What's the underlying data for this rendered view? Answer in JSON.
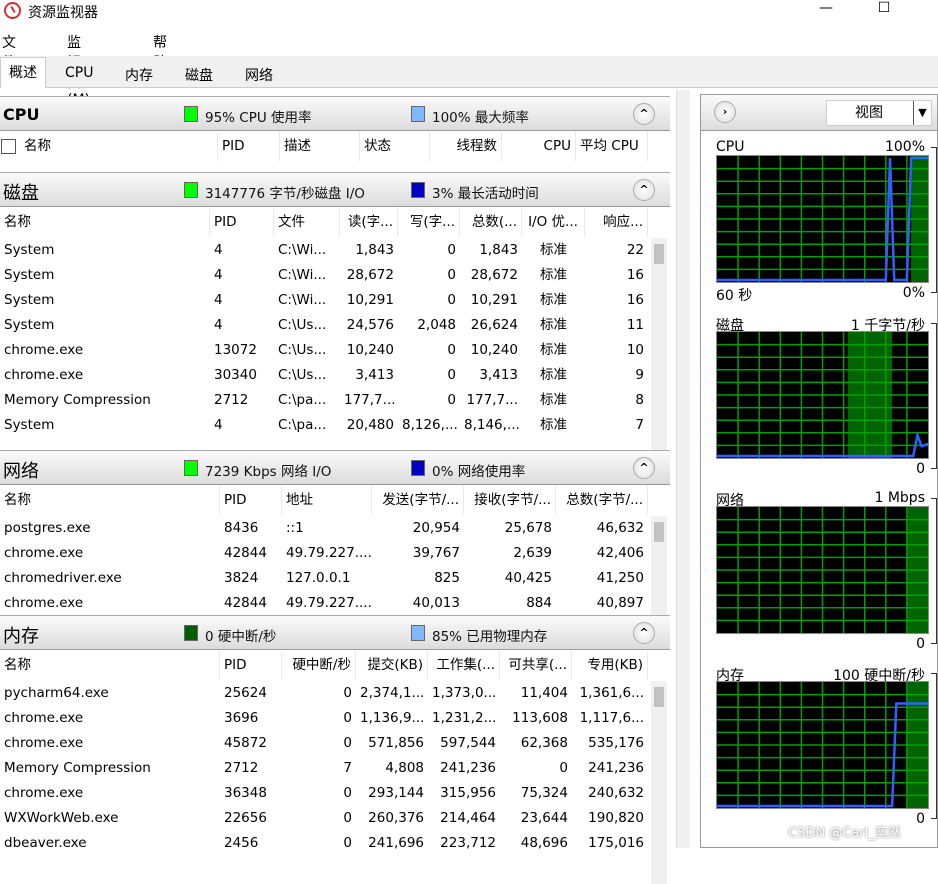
{
  "window": {
    "title": "资源监视器",
    "minimize": "—",
    "maximize": "☐"
  },
  "menu": [
    "文件(F)",
    "监视器(M)",
    "帮助(H)"
  ],
  "tabs": [
    "概述",
    "CPU",
    "内存",
    "磁盘",
    "网络"
  ],
  "active_tab": "概述",
  "colors": {
    "green": "#00ff00",
    "light_blue": "#80b8ff",
    "dark_blue": "#0000c0",
    "dark_green": "#006000",
    "graph_grid": "#00a000",
    "graph_line": "#3060ff"
  },
  "cpu": {
    "title": "CPU",
    "stat1": "95% CPU 使用率",
    "stat2": "100% 最大频率",
    "columns": [
      "名称",
      "PID",
      "描述",
      "状态",
      "线程数",
      "CPU",
      "平均 CPU"
    ],
    "rows": []
  },
  "disk": {
    "title": "磁盘",
    "stat1": "3147776 字节/秒磁盘 I/O",
    "stat2": "3% 最长活动时间",
    "columns": [
      "名称",
      "PID",
      "文件",
      "读(字...",
      "写(字...",
      "总数(...",
      "I/O 优...",
      "响应..."
    ],
    "rows": [
      [
        "System",
        "4",
        "C:\\Wi...",
        "1,843",
        "0",
        "1,843",
        "标准",
        "22"
      ],
      [
        "System",
        "4",
        "C:\\Wi...",
        "28,672",
        "0",
        "28,672",
        "标准",
        "16"
      ],
      [
        "System",
        "4",
        "C:\\Wi...",
        "10,291",
        "0",
        "10,291",
        "标准",
        "16"
      ],
      [
        "System",
        "4",
        "C:\\Us...",
        "24,576",
        "2,048",
        "26,624",
        "标准",
        "11"
      ],
      [
        "chrome.exe",
        "13072",
        "C:\\Us...",
        "10,240",
        "0",
        "10,240",
        "标准",
        "10"
      ],
      [
        "chrome.exe",
        "30340",
        "C:\\Us...",
        "3,413",
        "0",
        "3,413",
        "标准",
        "9"
      ],
      [
        "Memory Compression",
        "2712",
        "C:\\pa...",
        "177,7...",
        "0",
        "177,7...",
        "标准",
        "8"
      ],
      [
        "System",
        "4",
        "C:\\pa...",
        "20,480",
        "8,126,...",
        "8,146,...",
        "标准",
        "7"
      ]
    ]
  },
  "network": {
    "title": "网络",
    "stat1": "7239 Kbps 网络 I/O",
    "stat2": "0% 网络使用率",
    "columns": [
      "名称",
      "PID",
      "地址",
      "发送(字节/...",
      "接收(字节/...",
      "总数(字节/..."
    ],
    "rows": [
      [
        "postgres.exe",
        "8436",
        "::1",
        "20,954",
        "25,678",
        "46,632"
      ],
      [
        "chrome.exe",
        "42844",
        "49.79.227....",
        "39,767",
        "2,639",
        "42,406"
      ],
      [
        "chromedriver.exe",
        "3824",
        "127.0.0.1",
        "825",
        "40,425",
        "41,250"
      ],
      [
        "chrome.exe",
        "42844",
        "49.79.227....",
        "40,013",
        "884",
        "40,897"
      ]
    ]
  },
  "memory": {
    "title": "内存",
    "stat1": "0 硬中断/秒",
    "stat2": "85% 已用物理内存",
    "columns": [
      "名称",
      "PID",
      "硬中断/秒",
      "提交(KB)",
      "工作集(...",
      "可共享(...",
      "专用(KB)"
    ],
    "rows": [
      [
        "pycharm64.exe",
        "25624",
        "0",
        "2,374,1...",
        "1,373,0...",
        "11,404",
        "1,361,6..."
      ],
      [
        "chrome.exe",
        "3696",
        "0",
        "1,136,9...",
        "1,231,2...",
        "113,608",
        "1,117,6..."
      ],
      [
        "chrome.exe",
        "45872",
        "0",
        "571,856",
        "597,544",
        "62,368",
        "535,176"
      ],
      [
        "Memory Compression",
        "2712",
        "7",
        "4,808",
        "241,236",
        "0",
        "241,236"
      ],
      [
        "chrome.exe",
        "36348",
        "0",
        "293,144",
        "315,956",
        "75,324",
        "240,632"
      ],
      [
        "WXWorkWeb.exe",
        "22656",
        "0",
        "260,376",
        "214,464",
        "23,644",
        "190,820"
      ],
      [
        "dbeaver.exe",
        "2456",
        "0",
        "241,696",
        "223,712",
        "48,696",
        "175,016"
      ]
    ]
  },
  "graphs": {
    "view_label": "视图",
    "cpu": {
      "label": "CPU",
      "max": "100%",
      "time": "60 秒",
      "min": "0%"
    },
    "disk": {
      "label": "磁盘",
      "max": "1 千字节/秒",
      "min": "0"
    },
    "network": {
      "label": "网络",
      "max": "1 Mbps",
      "min": "0"
    },
    "memory": {
      "label": "内存",
      "max": "100 硬中断/秒",
      "min": "0"
    }
  },
  "watermark": "CSDN @Carl_奕然"
}
